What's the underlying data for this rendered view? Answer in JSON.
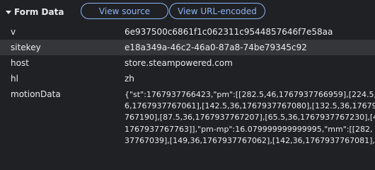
{
  "section": {
    "title": "Form Data",
    "view_source_label": "View source",
    "view_url_encoded_label": "View URL-encoded"
  },
  "fields": {
    "v": {
      "key": "v",
      "value": "6e937500c6861f1c062311c9544857646f7e58aa"
    },
    "sitekey": {
      "key": "sitekey",
      "value": "e18a349a-46c2-46a0-87a8-74be79345c92"
    },
    "host": {
      "key": "host",
      "value": "store.steampowered.com"
    },
    "hl": {
      "key": "hl",
      "value": "zh"
    },
    "motionData": {
      "key": "motionData",
      "value": "{\"st\":1767937766423,\"pm\":[[282.5,46,1767937766959],[224.5,46,1767937767061],[142.5,36,1767937767080],[132.5,36,1767937767190],[87.5,36,1767937767207],[65.5,36,1767937767230],[41767937767763]],\"pm-mp\":16.079999999999995,\"mm\":[[282,37767039],[149,36,1767937767062],[142,36,1767937767081],",
      "lines": [
        "{\"st\":1767937766423,\"pm\":[[282.5,46,1767937766959],[224.5,4",
        "6,1767937767061],[142.5,36,1767937767080],[132.5,36,17679377",
        "767190],[87.5,36,1767937767207],[65.5,36,1767937767230],[4",
        "1767937767763]],\"pm-mp\":16.079999999999995,\"mm\":[[282,",
        "37767039],[149,36,1767937767062],[142,36,1767937767081],"
      ]
    }
  }
}
